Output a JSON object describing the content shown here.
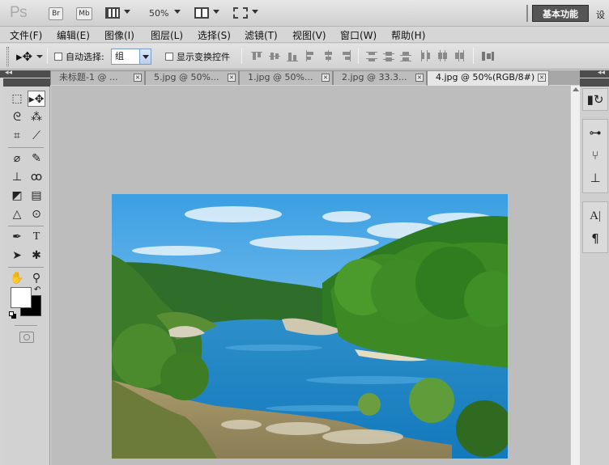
{
  "app": {
    "logo": "Ps",
    "bridge_label": "Br",
    "minibridge_label": "Mb",
    "zoom_level": "50%",
    "workspace_button": "基本功能",
    "workspace_more": "设"
  },
  "menu": {
    "items": [
      "文件(F)",
      "编辑(E)",
      "图像(I)",
      "图层(L)",
      "选择(S)",
      "滤镜(T)",
      "视图(V)",
      "窗口(W)",
      "帮助(H)"
    ]
  },
  "options": {
    "auto_select_label": "自动选择:",
    "auto_select_value": "组",
    "show_transform_label": "显示变换控件"
  },
  "tabs": [
    {
      "label": "未标题-1 @ ...",
      "active": false
    },
    {
      "label": "5.jpg @ 50%...",
      "active": false
    },
    {
      "label": "1.jpg @ 50%...",
      "active": false
    },
    {
      "label": "2.jpg @ 33.3...",
      "active": false
    },
    {
      "label": "4.jpg @ 50%(RGB/8#)",
      "active": true
    }
  ],
  "tab_close_glyph": "×",
  "colors": {
    "foreground": "#ffffff",
    "background": "#000000",
    "sky_top": "#3a9ee0",
    "water": "#1f8ed1",
    "foliage": "#3c8a25"
  }
}
